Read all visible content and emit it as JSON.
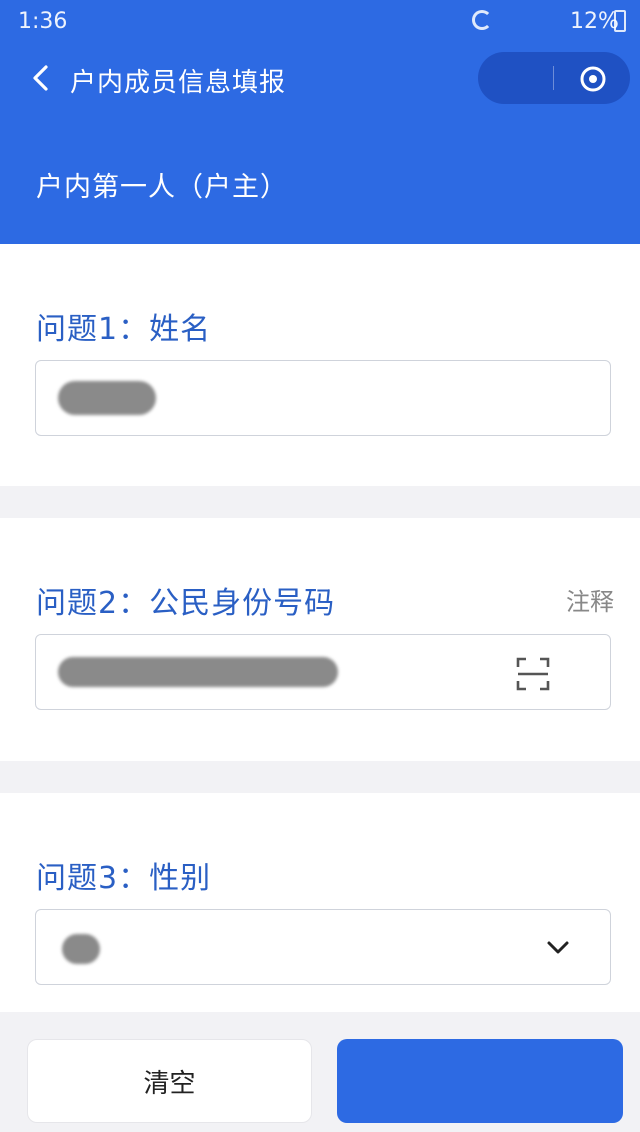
{
  "status_bar": {
    "time": "1:36",
    "battery": "12%"
  },
  "nav": {
    "title": "户内成员信息填报"
  },
  "section": {
    "title": "户内第一人（户主）"
  },
  "questions": [
    {
      "label": "问题1：姓名",
      "value": ""
    },
    {
      "label": "问题2：公民身份号码",
      "note": "注释",
      "value": ""
    },
    {
      "label": "问题3：性别",
      "value": ""
    }
  ],
  "buttons": {
    "clear": "清空",
    "submit": ""
  },
  "icons": {
    "back": "chevron-left-icon",
    "close": "circle-close-icon",
    "scan": "scan-icon",
    "dropdown": "chevron-down-icon"
  },
  "colors": {
    "primary": "#2d6ae3",
    "question_label": "#2a5fc4"
  }
}
